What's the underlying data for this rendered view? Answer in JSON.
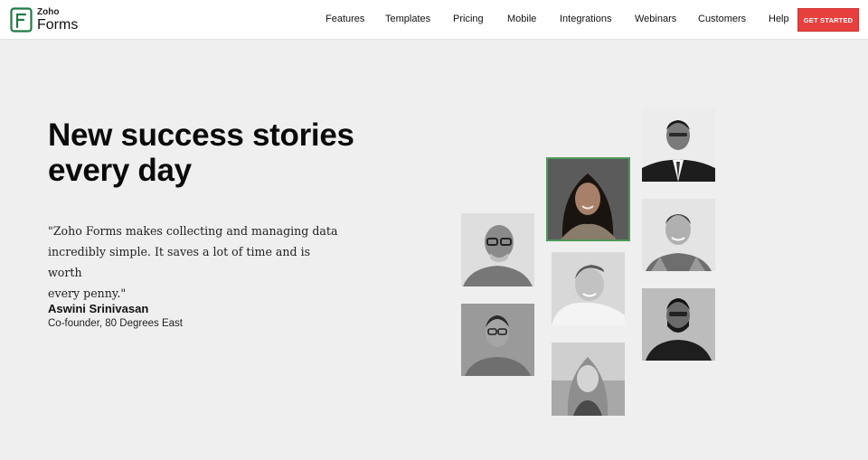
{
  "brand": {
    "small": "Zoho",
    "big": "Forms",
    "icon": "zoho-forms-logo-icon",
    "color": "#1e7a44"
  },
  "nav": {
    "links": [
      "Features",
      "Templates",
      "Pricing",
      "Mobile",
      "Integrations",
      "Webinars",
      "Customers",
      "Help"
    ],
    "cta": "GET STARTED",
    "cta_color": "#e8403f"
  },
  "hero": {
    "headline_line1": "New success stories",
    "headline_line2": "every day",
    "quote_line1": "\"Zoho Forms makes collecting and managing data",
    "quote_line2": "incredibly simple. It saves a lot of time and is worth",
    "quote_line3": "every penny.\"",
    "author": "Aswini Srinivasan",
    "role": "Co-founder, 80 Degrees East"
  },
  "photos": [
    {
      "name": "customer-photo-man-suit",
      "style": "grayscale"
    },
    {
      "name": "customer-photo-woman-featured",
      "style": "color"
    },
    {
      "name": "customer-photo-man-smiling",
      "style": "grayscale"
    },
    {
      "name": "customer-photo-man-glasses-bald",
      "style": "grayscale"
    },
    {
      "name": "customer-photo-young-man",
      "style": "grayscale"
    },
    {
      "name": "customer-photo-bearded-man",
      "style": "grayscale"
    },
    {
      "name": "customer-photo-man-glasses-young",
      "style": "grayscale"
    },
    {
      "name": "customer-photo-woman-field",
      "style": "grayscale"
    }
  ]
}
